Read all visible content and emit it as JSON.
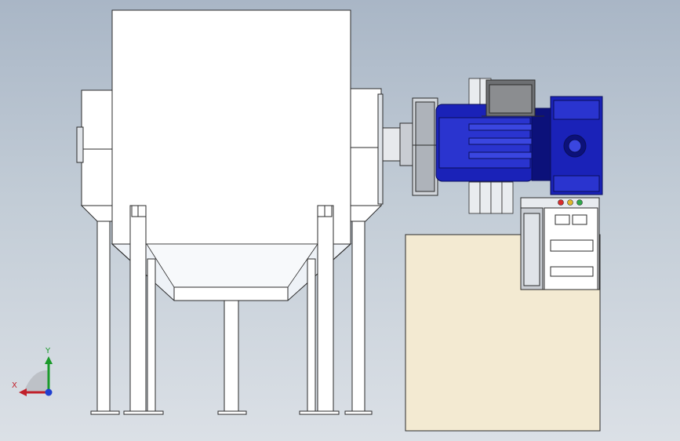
{
  "viewport": {
    "background_top": "#a9b6c6",
    "background_bottom": "#dbe0e6"
  },
  "colors": {
    "hopper_fill": "#ffffff",
    "hopper_inner_fill": "#eef2f7",
    "outline": "#2b2b2b",
    "motor_blue": "#1a22b8",
    "motor_blue_dark": "#0c117a",
    "motor_blue_light": "#3a46e0",
    "cabinet_fill": "#f3ead2",
    "steel_light": "#dfe3e8",
    "steel_mid": "#b7bcc3",
    "steel_dark": "#5c5f63",
    "indicator_red": "#d92b2b",
    "indicator_yellow": "#e0b72a",
    "indicator_green": "#2fa84a"
  },
  "triad": {
    "x_label": "X",
    "y_label": "Y",
    "x_color": "#c0202a",
    "y_color": "#1a9a2a",
    "z_color": "#1f3fd0"
  }
}
